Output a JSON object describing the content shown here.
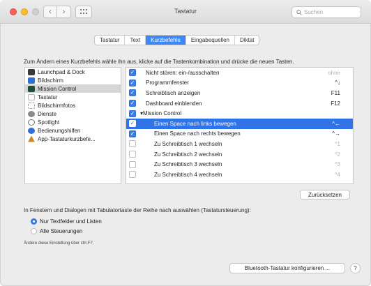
{
  "window": {
    "title": "Tastatur"
  },
  "search": {
    "placeholder": "Suchen"
  },
  "tabs": [
    {
      "label": "Tastatur",
      "active": false
    },
    {
      "label": "Text",
      "active": false
    },
    {
      "label": "Kurzbefehle",
      "active": true
    },
    {
      "label": "Eingabequellen",
      "active": false
    },
    {
      "label": "Diktat",
      "active": false
    }
  ],
  "instruction": "Zum Ändern eines Kurzbefehls wähle ihn aus, klicke auf die Tastenkombination und drücke die neuen Tasten.",
  "categories": [
    {
      "label": "Launchpad & Dock",
      "icon": "launchpad-icon",
      "color": "#3a3a3a",
      "selected": false
    },
    {
      "label": "Bildschirm",
      "icon": "display-icon",
      "color": "#2f6fd6",
      "selected": false
    },
    {
      "label": "Mission Control",
      "icon": "mission-control-icon",
      "color": "#1f4f3a",
      "selected": true
    },
    {
      "label": "Tastatur",
      "icon": "keyboard-icon",
      "color": "#b5b5b5",
      "selected": false
    },
    {
      "label": "Bildschirmfotos",
      "icon": "screenshot-icon",
      "color": "#9a9a9a",
      "selected": false
    },
    {
      "label": "Dienste",
      "icon": "gear-icon",
      "color": "#8a8a8a",
      "selected": false
    },
    {
      "label": "Spotlight",
      "icon": "spotlight-icon",
      "color": "#6e6e6e",
      "selected": false
    },
    {
      "label": "Bedienungshilfen",
      "icon": "accessibility-icon",
      "color": "#2f6fd6",
      "selected": false
    },
    {
      "label": "App-Tastaturkurzbefe...",
      "icon": "app-shortcuts-icon",
      "color": "#c98a2a",
      "selected": false
    }
  ],
  "shortcuts": [
    {
      "label": "Nicht stören: ein-/ausschalten",
      "key": "ohne",
      "checked": true,
      "level": 0,
      "selected": false,
      "dim": true
    },
    {
      "label": "Programmfenster",
      "key": "^↓",
      "checked": true,
      "level": 0,
      "selected": false,
      "dim": false
    },
    {
      "label": "Schreibtisch anzeigen",
      "key": "F11",
      "checked": true,
      "level": 0,
      "selected": false,
      "dim": false
    },
    {
      "label": "Dashboard einblenden",
      "key": "F12",
      "checked": true,
      "level": 0,
      "selected": false,
      "dim": false
    },
    {
      "label": "Mission Control",
      "key": "",
      "checked": true,
      "level": "group",
      "selected": false,
      "dim": false
    },
    {
      "label": "Einen Space nach links bewegen",
      "key": "^←",
      "checked": true,
      "level": 1,
      "selected": true,
      "dim": false
    },
    {
      "label": "Einen Space nach rechts bewegen",
      "key": "^→",
      "checked": true,
      "level": 1,
      "selected": false,
      "dim": false
    },
    {
      "label": "Zu Schreibtisch 1 wechseln",
      "key": "^1",
      "checked": false,
      "level": 1,
      "selected": false,
      "dim": true
    },
    {
      "label": "Zu Schreibtisch 2 wechseln",
      "key": "^2",
      "checked": false,
      "level": 1,
      "selected": false,
      "dim": true
    },
    {
      "label": "Zu Schreibtisch 3 wechseln",
      "key": "^3",
      "checked": false,
      "level": 1,
      "selected": false,
      "dim": true
    },
    {
      "label": "Zu Schreibtisch 4 wechseln",
      "key": "^4",
      "checked": false,
      "level": 1,
      "selected": false,
      "dim": true
    }
  ],
  "reset_button": "Zurücksetzen",
  "keyboard_navigation": {
    "text": "In Fenstern und Dialogen mit Tabulatortaste der Reihe nach auswählen (Tastatursteuerung):",
    "options": [
      {
        "label": "Nur Textfelder und Listen",
        "selected": true
      },
      {
        "label": "Alle Steuerungen",
        "selected": false
      }
    ],
    "hint": "Ändere diese Einstellung über ctrl-F7."
  },
  "bluetooth_button": "Bluetooth-Tastatur konfigurieren ...",
  "help_button": "?",
  "colors": {
    "accent": "#3d88f5",
    "selection": "#2f73e6"
  }
}
